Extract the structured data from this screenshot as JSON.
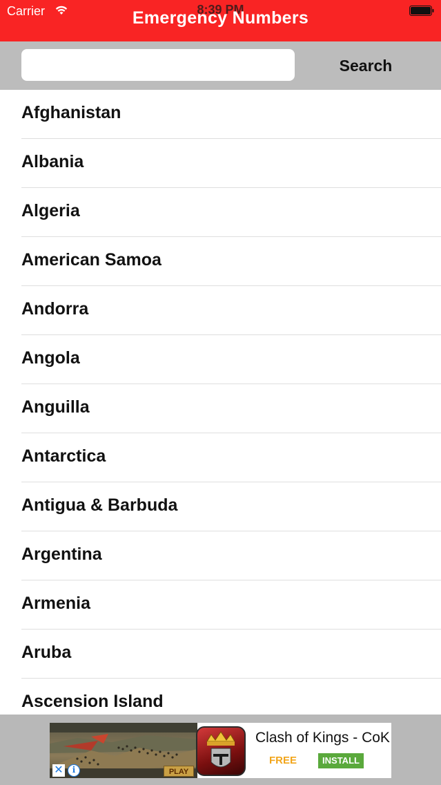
{
  "status_bar": {
    "carrier": "Carrier",
    "time": "8:39 PM"
  },
  "header": {
    "title": "Emergency Numbers",
    "background_color": "#f92424"
  },
  "search": {
    "value": "",
    "placeholder": "",
    "button_label": "Search"
  },
  "countries": [
    "Afghanistan",
    "Albania",
    "Algeria",
    "American Samoa",
    "Andorra",
    "Angola",
    "Anguilla",
    "Antarctica",
    "Antigua & Barbuda",
    "Argentina",
    "Armenia",
    "Aruba",
    "Ascension Island"
  ],
  "ad": {
    "title": "Clash of Kings - CoK",
    "price": "FREE",
    "install_label": "INSTALL",
    "play_label": "PLAY",
    "install_color": "#5aa93c",
    "price_color": "#f2a51a"
  }
}
